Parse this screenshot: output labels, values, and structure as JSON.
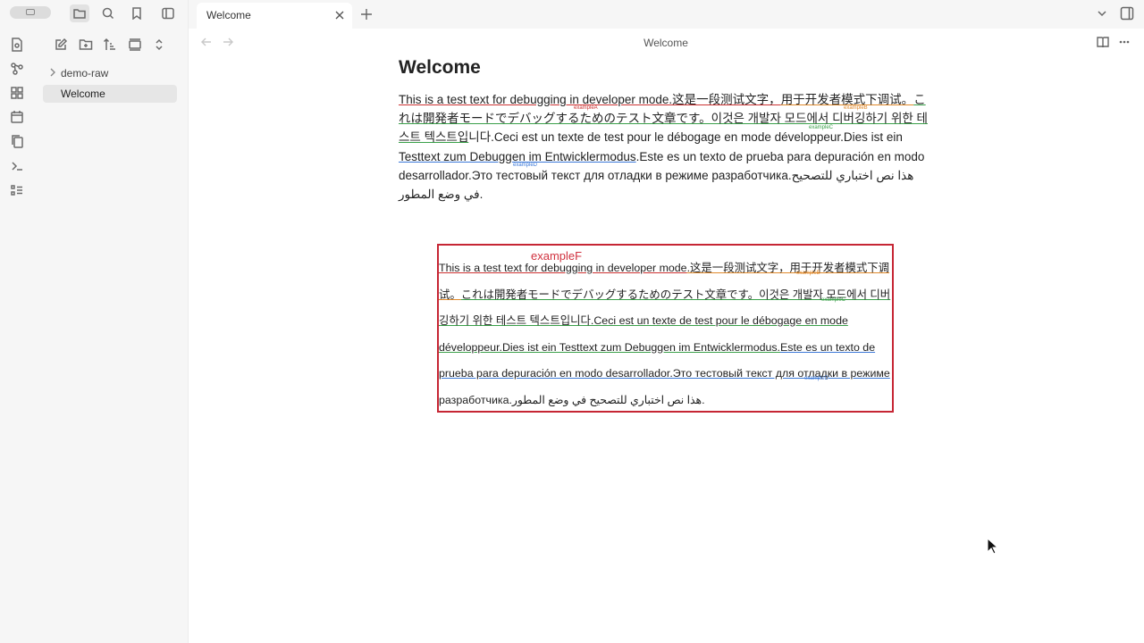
{
  "titlebar": {
    "tab_title": "Welcome"
  },
  "sidebar": {
    "tree": [
      {
        "label": "demo-raw",
        "type": "folder"
      },
      {
        "label": "Welcome",
        "type": "file",
        "selected": true
      }
    ]
  },
  "view": {
    "header_title": "Welcome",
    "heading": "Welcome",
    "paragraph": {
      "seg1": "This is a test text for debugging in developer mode.这是一段测试文字，",
      "seg2": "用于开发者模式下调试。",
      "seg3": "これは開発者モードでデバッグするためのテスト文章です。이것은 개발자 모드에서 디버깅하기 위한 테스트 텍스트입",
      "seg4": "니다.Ceci est un texte de test pour le débogage en mode développeur.Dies ist ein ",
      "seg5": "Testtext zum Debuggen im Entwicklermodus",
      "seg6": ".Este es un texto de prueba para depuración en modo desarrollador.Это тестовый текст для отладки в режиме разработчика.هذا نص اختباري للتصحيح في وضع المطور."
    },
    "paragraph_tags": {
      "a": "exampleA",
      "b": "exampleB",
      "c": "exampleC",
      "d": "exampleD"
    },
    "box": {
      "title": "exampleF",
      "seg1": "This is a test text for debugging in developer mode",
      "seg2": ".这是一段测试文字，用于开发者模式下调试。",
      "seg3": "これは開発者モードでデバッグするためのテスト文章です。이것은 개발자 모드에서 디버깅하기 위한 테스트 텍스트입니다.Ceci est un texte de test pour le débogage en mode développeur.Dies ist ein Testtext zum Debuggen im Entwicklermodus.",
      "seg4": "Este es un texto de prueba para depuración en modo desarrollador.Это тестовый текст для отладки в режиме",
      "seg5": " разработчика.هذا نص اختباري للتصحيح في وضع المطور.",
      "tags": {
        "b": "exampleB",
        "c": "exampleC",
        "d": "exampleD"
      }
    }
  },
  "colors": {
    "accent_red": "#c62634",
    "underline_orange": "#e08a2c",
    "underline_green": "#3aa049",
    "underline_blue": "#3b78d8"
  }
}
